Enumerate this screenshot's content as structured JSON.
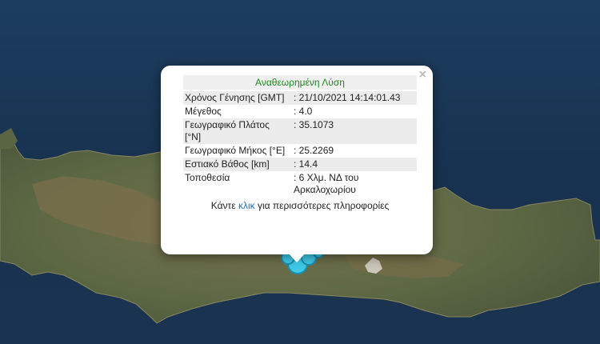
{
  "popup": {
    "title": "Αναθεωρημένη Λύση",
    "close_symbol": "×",
    "rows": [
      {
        "label": "Χρόνος Γένησης [GMT]",
        "value": ": 21/10/2021 14:14:01.43"
      },
      {
        "label": "Μέγεθος",
        "value": ": 4.0"
      },
      {
        "label": "Γεωγραφικό Πλάτος [°N]",
        "value": ": 35.1073"
      },
      {
        "label": "Γεωγραφικό Μήκος [°E]",
        "value": ": 25.2269"
      },
      {
        "label": "Εστιακό Βάθος [km]",
        "value": ": 14.4"
      },
      {
        "label": "Τοποθεσία",
        "value": ": 6 Χλμ. ΝΔ του Αρκαλοχωρίου"
      }
    ],
    "more_prefix": "Κάντε",
    "more_link": "κλικ",
    "more_suffix": "για περισσότερες πληροφορίες"
  },
  "colors": {
    "sea": "#17324f",
    "land": "#6b6a4a",
    "marker": "#3ec9e8"
  },
  "map": {
    "markers": [
      {
        "lon": 25.2269,
        "lat": 35.1073,
        "magnitude": 4.0
      }
    ]
  }
}
